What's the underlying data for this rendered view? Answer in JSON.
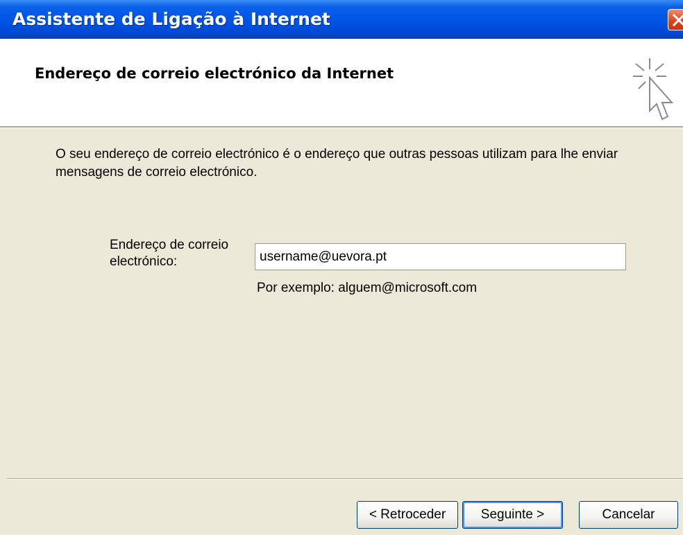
{
  "window": {
    "title": "Assistente de Ligação à Internet",
    "close_icon": "close-icon"
  },
  "header": {
    "title": "Endereço de correio electrónico da Internet",
    "icon": "cursor-sparkle-icon"
  },
  "body": {
    "description": "O seu endereço de correio electrónico é o endereço que outras pessoas utilizam para lhe enviar mensagens de correio electrónico."
  },
  "email_field": {
    "label": "Endereço de correio electrónico:",
    "value": "username@uevora.pt",
    "example": "Por exemplo: alguem@microsoft.com"
  },
  "buttons": {
    "back": "< Retroceder",
    "next": "Seguinte >",
    "cancel": "Cancelar"
  },
  "colors": {
    "titlebar": "#0055e5",
    "dialog_bg": "#ece9d8",
    "close_button": "#d8431c"
  }
}
